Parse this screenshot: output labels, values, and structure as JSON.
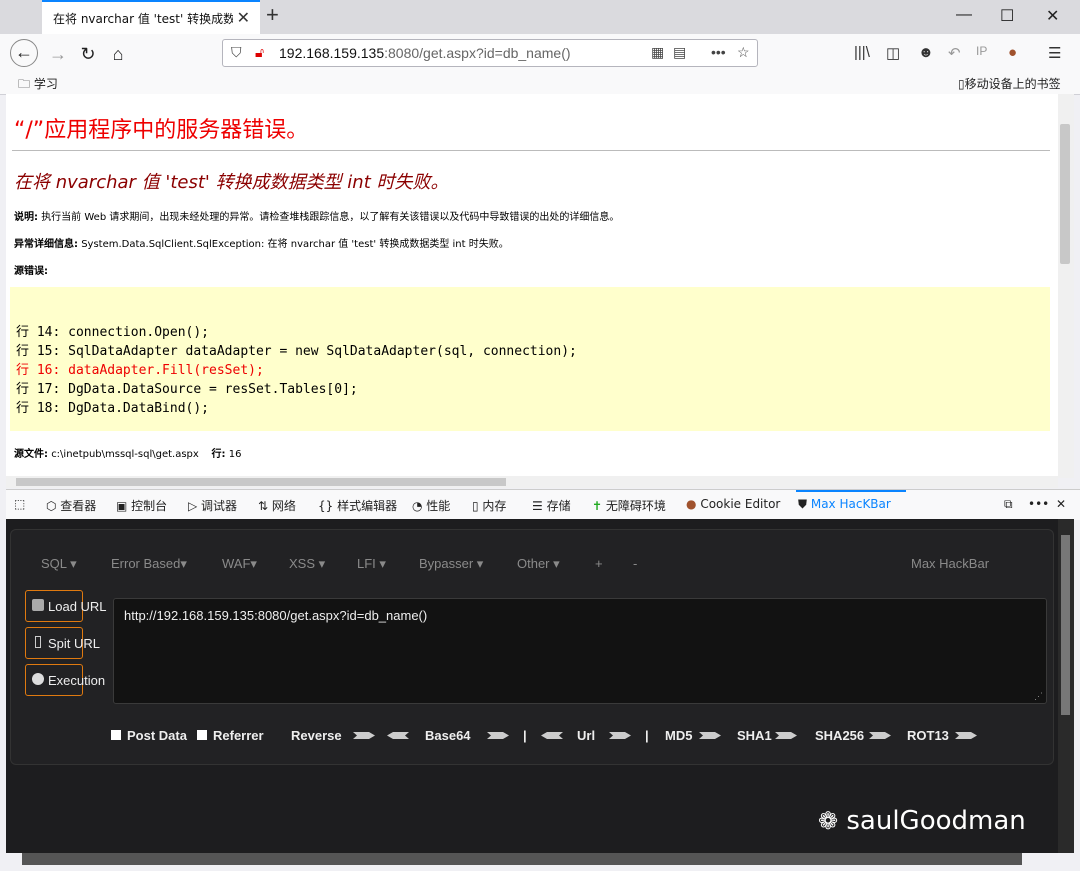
{
  "tab": {
    "title": "在将 nvarchar 值 'test' 转换成数据类型"
  },
  "nav": {
    "url_host": "192.168.159.135",
    "url_rest": ":8080/get.aspx?id=db_name()"
  },
  "bookmarks": {
    "folder": "学习",
    "mobile": "移动设备上的书签"
  },
  "page": {
    "title": "“/”应用程序中的服务器错误。",
    "error": "在将 nvarchar 值 'test' 转换成数据类型 int 时失败。",
    "desc_label": "说明:",
    "desc": "执行当前 Web 请求期间，出现未经处理的异常。请检查堆栈跟踪信息，以了解有关该错误以及代码中导致错误的出处的详细信息。",
    "exc_label": "异常详细信息:",
    "exc": "System.Data.SqlClient.SqlException: 在将 nvarchar 值 'test' 转换成数据类型 int 时失败。",
    "src_label": "源错误:",
    "code": [
      "行 14: connection.Open();",
      "行 15: SqlDataAdapter dataAdapter = new SqlDataAdapter(sql, connection);",
      "行 16: dataAdapter.Fill(resSet);",
      "行 17: DgData.DataSource = resSet.Tables[0];",
      "行 18: DgData.DataBind();"
    ],
    "srcfile_label": "源文件:",
    "srcfile": "c:\\inetpub\\mssql-sql\\get.aspx",
    "line_label": "行:",
    "line_num": "16"
  },
  "devtools": {
    "tabs": [
      "查看器",
      "控制台",
      "调试器",
      "网络",
      "样式编辑器",
      "性能",
      "内存",
      "存储",
      "无障碍环境",
      "Cookie Editor",
      "Max HacKBar"
    ]
  },
  "hackbar": {
    "menu": [
      "SQL ▾",
      "Error Based▾",
      "WAF▾",
      "XSS ▾",
      "LFI ▾",
      "Bypasser ▾",
      "Other ▾",
      "+",
      "-"
    ],
    "brand": "Max HackBar",
    "load": "Load URL",
    "split": "Spit URL",
    "exec": "Execution",
    "url": "http://192.168.159.135:8080/get.aspx?id=db_name()",
    "opts": {
      "post": "Post Data",
      "referrer": "Referrer",
      "reverse": "Reverse",
      "base64": "Base64",
      "url": "Url",
      "md5": "MD5",
      "sha1": "SHA1",
      "sha256": "SHA256",
      "rot13": "ROT13",
      "sep": "|"
    }
  },
  "watermark": "saulGoodman"
}
